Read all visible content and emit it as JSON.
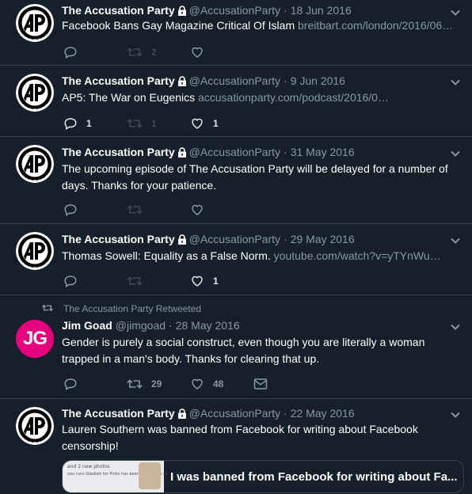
{
  "tweets": [
    {
      "name": "The Accusation Party",
      "handle": "@AccusationParty",
      "date": "18 Jun 2016",
      "text": "Facebook Bans Gay Magazine Critical Of Islam ",
      "link": "breitbart.com/london/2016/06…",
      "replies": "",
      "retweets": "2",
      "likes": ""
    },
    {
      "name": "The Accusation Party",
      "handle": "@AccusationParty",
      "date": "9 Jun 2016",
      "text": "AP5: The War on Eugenics ",
      "link": "accusationparty.com/podcast/2016/0…",
      "replies": "1",
      "retweets": "1",
      "likes": "1"
    },
    {
      "name": "The Accusation Party",
      "handle": "@AccusationParty",
      "date": "31 May 2016",
      "text": "The upcoming episode of The Accusation Party will be delayed for a number of days. Thanks for your patience.",
      "link": "",
      "replies": "",
      "retweets": "",
      "likes": ""
    },
    {
      "name": "The Accusation Party",
      "handle": "@AccusationParty",
      "date": "29 May 2016",
      "text": "Thomas Sowell: Equality as a False Norm. ",
      "link": "youtube.com/watch?v=yTYnWu…",
      "replies": "",
      "retweets": "",
      "likes": "1"
    },
    {
      "retweeted_by": "The Accusation Party Retweeted",
      "name": "Jim Goad",
      "handle": "@jimgoad",
      "date": "28 May 2016",
      "avatar_text": "JG",
      "text": "Gender is purely a social construct, even though you are literally a woman trapped in a man's body. Thanks for clearing that up.",
      "link": "",
      "replies": "",
      "retweets": "29",
      "likes": "48"
    },
    {
      "name": "The Accusation Party",
      "handle": "@AccusationParty",
      "date": "22 May 2016",
      "text": "Lauren Southern was banned from Facebook for writing about Facebook censorship!",
      "link": "",
      "card_title": "I was banned from Facebook for writing about Fa...",
      "card_thumb_line1": "and 2 new photos",
      "card_thumb_line2": "you runs Gladiatr for Pinks has been banned on all"
    }
  ],
  "colors": {
    "background": "#15202b",
    "divider": "#38444d",
    "muted": "#8899a6",
    "jg_pink": "#e6007e"
  }
}
